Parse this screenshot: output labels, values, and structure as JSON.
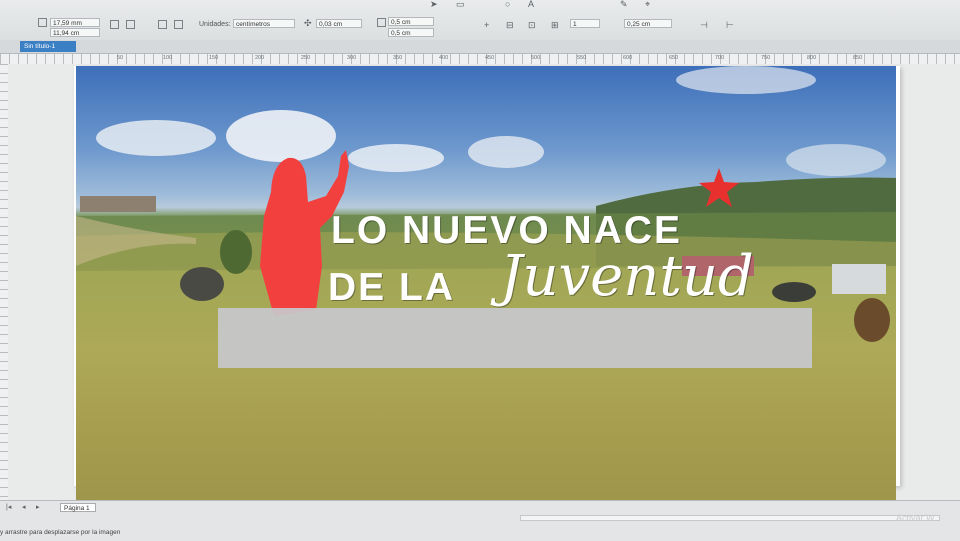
{
  "propbar": {
    "width_value": "17,59 mm",
    "height_value": "11,94 cm",
    "units_label": "Unidades:",
    "units_value": "centímetros",
    "nudge_value": "0,03 cm",
    "dup_x_value": "0,5 cm",
    "dup_y_value": "0,5 cm",
    "outline_value": "0,25 cm",
    "page_num": "1"
  },
  "tabs": {
    "active_label": "Sin título-1"
  },
  "ruler": {
    "ticks": [
      "50",
      "100",
      "150",
      "200",
      "250",
      "300",
      "350",
      "400",
      "450",
      "500",
      "550",
      "600",
      "650",
      "700",
      "750",
      "800",
      "850"
    ]
  },
  "canvas": {
    "headline_line1": "LO NUEVO NACE",
    "headline_line2": "DE LA",
    "script_word": "Juventud",
    "colors": {
      "figure": "#f2403f",
      "star": "#e8312f",
      "bar": "#c7c8cb",
      "text": "#ffffff"
    }
  },
  "status": {
    "page_tab": "Página 1",
    "hint_text": "y arrastre para desplazarse por la imagen",
    "watermark": "Activar W"
  }
}
